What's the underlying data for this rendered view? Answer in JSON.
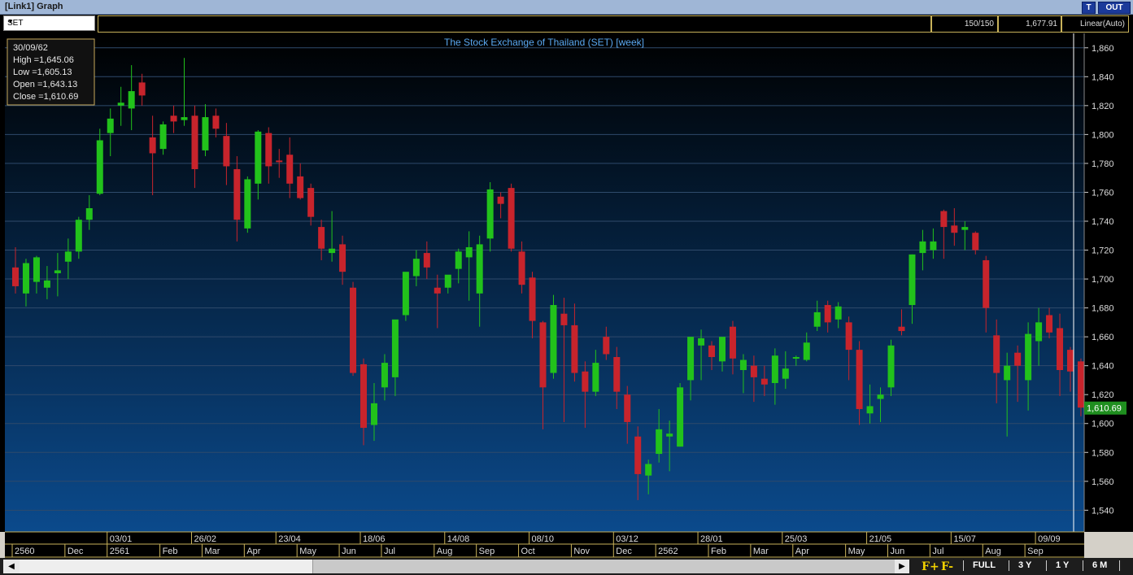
{
  "window": {
    "title": "[Link1] Graph",
    "t_button": "T",
    "out_button": "OUT"
  },
  "toolbar": {
    "symbol": "SET",
    "count": "150/150",
    "last_price": "1,677.91",
    "scale": "Linear(Auto)"
  },
  "info_box": {
    "date": "30/09/62",
    "high": "High  =1,645.06",
    "low": "Low  =1,605.13",
    "open": "Open  =1,643.13",
    "close": "Close  =1,610.69"
  },
  "colors": {
    "up": "#22c21b",
    "down": "#c8242c",
    "bg_top": "#000000",
    "bg_bottom": "#0b4a8c",
    "text": "#dddddd"
  },
  "bottom": {
    "f_plus": "F+",
    "f_minus": "F-",
    "ranges": [
      "FULL",
      "3 Y",
      "1 Y",
      "6 M"
    ]
  },
  "chart_data": {
    "type": "candlestick",
    "title": "The Stock Exchange of Thailand (SET) [week]",
    "ylim": [
      1525,
      1870
    ],
    "y_ticks": [
      1540,
      1560,
      1580,
      1600,
      1620,
      1640,
      1660,
      1680,
      1700,
      1720,
      1740,
      1760,
      1780,
      1800,
      1820,
      1840,
      1860
    ],
    "current_value": "1,610.69",
    "date_labels_top": [
      {
        "i": 9,
        "label": "03/01"
      },
      {
        "i": 17,
        "label": "26/02"
      },
      {
        "i": 25,
        "label": "23/04"
      },
      {
        "i": 33,
        "label": "18/06"
      },
      {
        "i": 41,
        "label": "14/08"
      },
      {
        "i": 49,
        "label": "08/10"
      },
      {
        "i": 57,
        "label": "03/12"
      },
      {
        "i": 65,
        "label": "28/01"
      },
      {
        "i": 73,
        "label": "25/03"
      },
      {
        "i": 81,
        "label": "21/05"
      },
      {
        "i": 89,
        "label": "15/07"
      },
      {
        "i": 97,
        "label": "09/09"
      }
    ],
    "date_labels_bottom": [
      {
        "i": 0,
        "label": "2560"
      },
      {
        "i": 5,
        "label": "Dec"
      },
      {
        "i": 9,
        "label": "2561"
      },
      {
        "i": 14,
        "label": "Feb"
      },
      {
        "i": 18,
        "label": "Mar"
      },
      {
        "i": 22,
        "label": "Apr"
      },
      {
        "i": 27,
        "label": "May"
      },
      {
        "i": 31,
        "label": "Jun"
      },
      {
        "i": 35,
        "label": "Jul"
      },
      {
        "i": 40,
        "label": "Aug"
      },
      {
        "i": 44,
        "label": "Sep"
      },
      {
        "i": 48,
        "label": "Oct"
      },
      {
        "i": 53,
        "label": "Nov"
      },
      {
        "i": 57,
        "label": "Dec"
      },
      {
        "i": 61,
        "label": "2562"
      },
      {
        "i": 66,
        "label": "Feb"
      },
      {
        "i": 70,
        "label": "Mar"
      },
      {
        "i": 74,
        "label": "Apr"
      },
      {
        "i": 79,
        "label": "May"
      },
      {
        "i": 83,
        "label": "Jun"
      },
      {
        "i": 87,
        "label": "Jul"
      },
      {
        "i": 92,
        "label": "Aug"
      },
      {
        "i": 96,
        "label": "Sep"
      }
    ],
    "ohlc": [
      [
        1708,
        1722,
        1690,
        1695
      ],
      [
        1690,
        1714,
        1681,
        1711
      ],
      [
        1698,
        1716,
        1690,
        1715
      ],
      [
        1694,
        1709,
        1686,
        1699
      ],
      [
        1704,
        1718,
        1688,
        1706
      ],
      [
        1712,
        1728,
        1700,
        1719
      ],
      [
        1719,
        1743,
        1714,
        1741
      ],
      [
        1741,
        1758,
        1734,
        1749
      ],
      [
        1759,
        1804,
        1758,
        1796
      ],
      [
        1801,
        1818,
        1785,
        1811
      ],
      [
        1820,
        1833,
        1806,
        1822
      ],
      [
        1818,
        1848,
        1803,
        1830
      ],
      [
        1836,
        1842,
        1820,
        1827
      ],
      [
        1798,
        1813,
        1758,
        1787
      ],
      [
        1790,
        1809,
        1786,
        1807
      ],
      [
        1813,
        1820,
        1801,
        1809
      ],
      [
        1810,
        1853,
        1806,
        1812
      ],
      [
        1813,
        1820,
        1763,
        1776
      ],
      [
        1789,
        1821,
        1785,
        1812
      ],
      [
        1813,
        1818,
        1798,
        1804
      ],
      [
        1799,
        1808,
        1765,
        1778
      ],
      [
        1776,
        1785,
        1726,
        1741
      ],
      [
        1735,
        1771,
        1732,
        1769
      ],
      [
        1766,
        1803,
        1755,
        1802
      ],
      [
        1801,
        1805,
        1766,
        1778
      ],
      [
        1782,
        1790,
        1770,
        1781
      ],
      [
        1786,
        1798,
        1756,
        1766
      ],
      [
        1771,
        1780,
        1755,
        1756
      ],
      [
        1763,
        1766,
        1737,
        1743
      ],
      [
        1736,
        1741,
        1713,
        1721
      ],
      [
        1718,
        1747,
        1712,
        1721
      ],
      [
        1724,
        1730,
        1696,
        1705
      ],
      [
        1694,
        1698,
        1633,
        1635
      ],
      [
        1641,
        1645,
        1585,
        1597
      ],
      [
        1599,
        1628,
        1588,
        1614
      ],
      [
        1625,
        1648,
        1616,
        1642
      ],
      [
        1632,
        1666,
        1619,
        1672
      ],
      [
        1675,
        1702,
        1671,
        1705
      ],
      [
        1702,
        1720,
        1695,
        1714
      ],
      [
        1718,
        1726,
        1700,
        1708
      ],
      [
        1694,
        1703,
        1666,
        1690
      ],
      [
        1694,
        1702,
        1690,
        1703
      ],
      [
        1707,
        1721,
        1697,
        1719
      ],
      [
        1715,
        1733,
        1685,
        1722
      ],
      [
        1690,
        1730,
        1667,
        1724
      ],
      [
        1728,
        1767,
        1719,
        1762
      ],
      [
        1757,
        1760,
        1742,
        1752
      ],
      [
        1763,
        1766,
        1719,
        1721
      ],
      [
        1719,
        1726,
        1690,
        1696
      ],
      [
        1701,
        1705,
        1659,
        1671
      ],
      [
        1670,
        1671,
        1596,
        1625
      ],
      [
        1635,
        1689,
        1631,
        1682
      ],
      [
        1676,
        1687,
        1601,
        1668
      ],
      [
        1668,
        1683,
        1629,
        1635
      ],
      [
        1636,
        1643,
        1597,
        1622
      ],
      [
        1622,
        1651,
        1619,
        1642
      ],
      [
        1660,
        1667,
        1644,
        1648
      ],
      [
        1646,
        1653,
        1610,
        1622
      ],
      [
        1620,
        1626,
        1586,
        1601
      ],
      [
        1591,
        1598,
        1547,
        1565
      ],
      [
        1564,
        1575,
        1551,
        1572
      ],
      [
        1579,
        1610,
        1573,
        1596
      ],
      [
        1591,
        1602,
        1567,
        1593
      ],
      [
        1584,
        1628,
        1584,
        1625
      ],
      [
        1630,
        1656,
        1616,
        1660
      ],
      [
        1654,
        1665,
        1630,
        1659
      ],
      [
        1654,
        1657,
        1637,
        1646
      ],
      [
        1643,
        1656,
        1636,
        1660
      ],
      [
        1667,
        1671,
        1634,
        1645
      ],
      [
        1637,
        1648,
        1621,
        1644
      ],
      [
        1640,
        1647,
        1615,
        1632
      ],
      [
        1631,
        1640,
        1619,
        1627
      ],
      [
        1628,
        1652,
        1613,
        1647
      ],
      [
        1631,
        1650,
        1624,
        1638
      ],
      [
        1645,
        1647,
        1640,
        1646
      ],
      [
        1644,
        1663,
        1643,
        1656
      ],
      [
        1667,
        1685,
        1664,
        1677
      ],
      [
        1682,
        1685,
        1663,
        1670
      ],
      [
        1672,
        1684,
        1666,
        1681
      ],
      [
        1670,
        1674,
        1630,
        1651
      ],
      [
        1651,
        1657,
        1599,
        1610
      ],
      [
        1607,
        1627,
        1600,
        1612
      ],
      [
        1617,
        1625,
        1601,
        1620
      ],
      [
        1625,
        1658,
        1619,
        1654
      ],
      [
        1667,
        1679,
        1661,
        1664
      ],
      [
        1682,
        1717,
        1669,
        1717
      ],
      [
        1718,
        1734,
        1706,
        1726
      ],
      [
        1720,
        1735,
        1714,
        1726
      ],
      [
        1747,
        1748,
        1714,
        1736
      ],
      [
        1737,
        1749,
        1723,
        1732
      ],
      [
        1734,
        1740,
        1720,
        1736
      ],
      [
        1732,
        1733,
        1717,
        1720
      ],
      [
        1713,
        1716,
        1663,
        1680
      ],
      [
        1661,
        1672,
        1614,
        1635
      ],
      [
        1630,
        1649,
        1591,
        1640
      ],
      [
        1649,
        1654,
        1615,
        1640
      ],
      [
        1630,
        1670,
        1609,
        1662
      ],
      [
        1657,
        1680,
        1640,
        1670
      ],
      [
        1675,
        1680,
        1659,
        1663
      ],
      [
        1666,
        1676,
        1619,
        1637
      ],
      [
        1651,
        1653,
        1622,
        1636
      ],
      [
        1643,
        1645,
        1605,
        1611
      ]
    ]
  }
}
